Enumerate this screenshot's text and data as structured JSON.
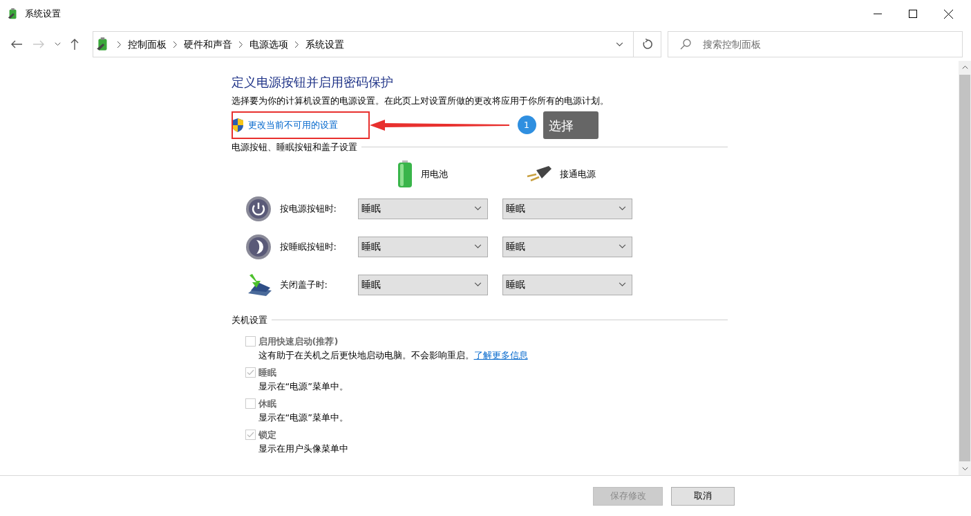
{
  "window": {
    "title": "系统设置"
  },
  "address_bar": {
    "breadcrumbs": [
      "控制面板",
      "硬件和声音",
      "电源选项",
      "系统设置"
    ]
  },
  "search": {
    "placeholder": "搜索控制面板"
  },
  "page": {
    "heading": "定义电源按钮并启用密码保护",
    "description": "选择要为你的计算机设置的电源设置。在此页上对设置所做的更改将应用于你所有的电源计划。",
    "admin_link": "更改当前不可用的设置"
  },
  "annotation": {
    "step": "1",
    "label": "选择"
  },
  "power_section": {
    "title": "电源按钮、睡眠按钮和盖子设置",
    "columns": [
      {
        "kind": "battery",
        "label": "用电池"
      },
      {
        "kind": "plugged",
        "label": "接通电源"
      }
    ],
    "rows": [
      {
        "kind": "power",
        "label": "按电源按钮时:",
        "values": [
          "睡眠",
          "睡眠"
        ]
      },
      {
        "kind": "sleep",
        "label": "按睡眠按钮时:",
        "values": [
          "睡眠",
          "睡眠"
        ]
      },
      {
        "kind": "lid",
        "label": "关闭盖子时:",
        "values": [
          "睡眠",
          "睡眠"
        ]
      }
    ]
  },
  "shutdown_section": {
    "title": "关机设置",
    "options": [
      {
        "label": "启用快速启动(推荐)",
        "checked": false,
        "disabled": true,
        "description": "这有助于在关机之后更快地启动电脑。不会影响重启。",
        "link": "了解更多信息"
      },
      {
        "label": "睡眠",
        "checked": true,
        "disabled": true,
        "description": "显示在“电源”菜单中。"
      },
      {
        "label": "休眠",
        "checked": false,
        "disabled": true,
        "description": "显示在“电源”菜单中。"
      },
      {
        "label": "锁定",
        "checked": true,
        "disabled": true,
        "description": "显示在用户头像菜单中"
      }
    ]
  },
  "buttons": [
    {
      "label": "保存修改",
      "disabled": true
    },
    {
      "label": "取消",
      "disabled": false
    }
  ]
}
